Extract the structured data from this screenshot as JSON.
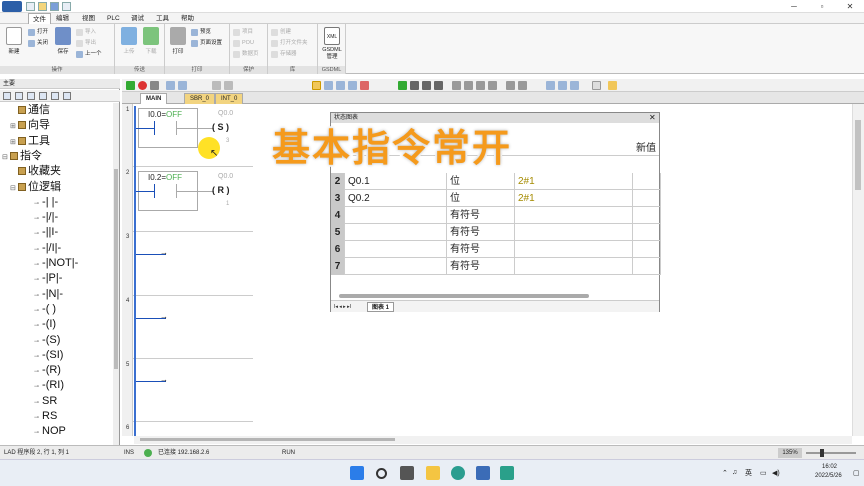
{
  "window": {
    "menus": [
      "文件",
      "编辑",
      "视图",
      "PLC",
      "调试",
      "工具",
      "帮助"
    ],
    "active_menu": "文件"
  },
  "ribbon": {
    "file_group": {
      "new": "新建",
      "open": "打开",
      "close": "关闭",
      "save": "保存",
      "import": "导入",
      "export": "导出",
      "prev": "上一个",
      "label": "操作"
    },
    "transfer": {
      "upload": "上传",
      "download": "下载",
      "label": "传送"
    },
    "print": {
      "print": "打印",
      "preview": "预览",
      "page_setup": "页面设置",
      "label": "打印"
    },
    "protect": {
      "encrypt": "项目",
      "pou": "POU",
      "datapage": "数据页",
      "label": "保护"
    },
    "library": {
      "create": "创建",
      "open_folder": "打开文件夹",
      "memory": "存储器",
      "label": "库"
    },
    "gsdml": {
      "btn": "GSDML\n管理",
      "label": "GSDML",
      "ico": "XML"
    }
  },
  "left_panel": {
    "title": "主要",
    "tree": [
      {
        "label": "通信",
        "indent": 0,
        "twisty": ""
      },
      {
        "label": "向导",
        "indent": 0,
        "twisty": "+"
      },
      {
        "label": "工具",
        "indent": 0,
        "twisty": "+"
      },
      {
        "label": "指令",
        "indent": -1,
        "twisty": "-"
      },
      {
        "label": "收藏夹",
        "indent": 0,
        "twisty": ""
      },
      {
        "label": "位逻辑",
        "indent": 0,
        "twisty": "-"
      },
      {
        "label": "-| |-",
        "indent": 1,
        "twisty": ""
      },
      {
        "label": "-|/|-",
        "indent": 1,
        "twisty": ""
      },
      {
        "label": "-||I-",
        "indent": 1,
        "twisty": ""
      },
      {
        "label": "-|/I|-",
        "indent": 1,
        "twisty": ""
      },
      {
        "label": "-|NOT|-",
        "indent": 1,
        "twisty": ""
      },
      {
        "label": "-|P|-",
        "indent": 1,
        "twisty": ""
      },
      {
        "label": "-|N|-",
        "indent": 1,
        "twisty": ""
      },
      {
        "label": "-( )",
        "indent": 1,
        "twisty": ""
      },
      {
        "label": "-(I)",
        "indent": 1,
        "twisty": ""
      },
      {
        "label": "-(S)",
        "indent": 1,
        "twisty": ""
      },
      {
        "label": "-(SI)",
        "indent": 1,
        "twisty": ""
      },
      {
        "label": "-(R)",
        "indent": 1,
        "twisty": ""
      },
      {
        "label": "-(RI)",
        "indent": 1,
        "twisty": ""
      },
      {
        "label": "SR",
        "indent": 1,
        "twisty": ""
      },
      {
        "label": "RS",
        "indent": 1,
        "twisty": ""
      },
      {
        "label": "NOP",
        "indent": 1,
        "twisty": ""
      }
    ]
  },
  "tabs": [
    "MAIN",
    "SBR_0",
    "INT_0"
  ],
  "ladder": {
    "networks": [
      "1",
      "2",
      "3",
      "4",
      "5",
      "6"
    ],
    "n1": {
      "contact": "I0.0=",
      "state": "OFF",
      "coil_addr": "Q0.0",
      "coil": "S",
      "coil_n": "3"
    },
    "n2": {
      "contact": "I0.2=",
      "state": "OFF",
      "coil_addr": "Q0.0",
      "coil": "R",
      "coil_n": "1"
    }
  },
  "status_table": {
    "title": "状态图表",
    "header_new": "新值",
    "rows": [
      {
        "n": "2",
        "addr": "Q0.1",
        "fmt": "位",
        "val": "2#1"
      },
      {
        "n": "3",
        "addr": "Q0.2",
        "fmt": "位",
        "val": "2#1"
      },
      {
        "n": "4",
        "addr": "",
        "fmt": "有符号",
        "val": ""
      },
      {
        "n": "5",
        "addr": "",
        "fmt": "有符号",
        "val": ""
      },
      {
        "n": "6",
        "addr": "",
        "fmt": "有符号",
        "val": ""
      },
      {
        "n": "7",
        "addr": "",
        "fmt": "有符号",
        "val": ""
      }
    ],
    "sheet_tab": "图表 1",
    "nav": "I◂ ◂ ▸ ▸I"
  },
  "overlay_title": "基本指令常开",
  "statusbar": {
    "pos": "LAD 程序段 2, 行 1, 列 1",
    "ins": "INS",
    "conn": "已连接 192.168.2.6",
    "run": "RUN",
    "zoom": "135%"
  },
  "tray": {
    "lang": "英",
    "time": "16:02",
    "date": "2022/5/26"
  }
}
